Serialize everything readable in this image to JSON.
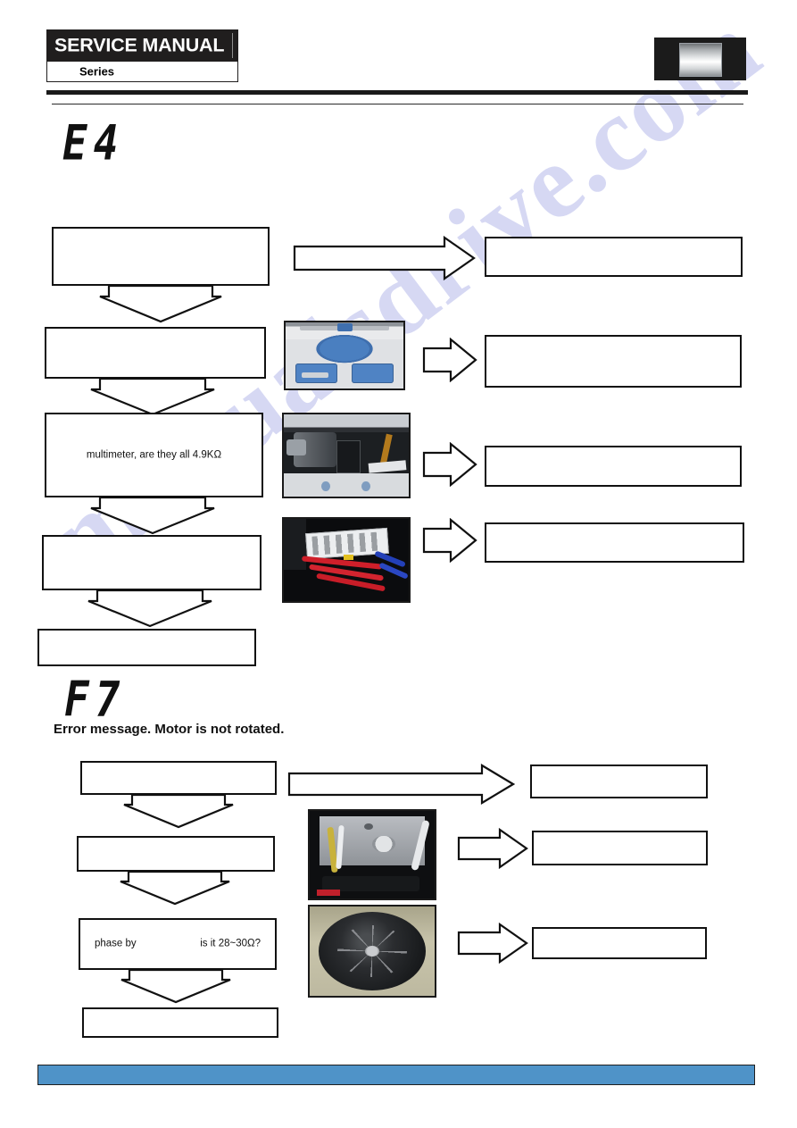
{
  "header": {
    "title": "SERVICE MANUAL",
    "series_label": "Series",
    "logo_name": "brand-logo"
  },
  "sections": [
    {
      "id": "e4",
      "code": "E4",
      "caption": "",
      "flow_boxes": [
        {
          "text": ""
        },
        {
          "text": ""
        },
        {
          "text": "multimeter, are they all 4.9KΩ"
        },
        {
          "text": ""
        },
        {
          "text": ""
        }
      ],
      "result_boxes": [
        {
          "text": ""
        },
        {
          "text": ""
        },
        {
          "text": ""
        },
        {
          "text": ""
        }
      ],
      "photos": [
        {
          "name": "detergent-dispenser-photo"
        },
        {
          "name": "water-inlet-valve-photo"
        },
        {
          "name": "wire-connector-photo"
        }
      ]
    },
    {
      "id": "f7",
      "code": "F7",
      "caption": "Error message. Motor is not rotated.",
      "flow_boxes": [
        {
          "text": ""
        },
        {
          "text": ""
        },
        {
          "text_left": "phase by",
          "text_right": "is it 28~30Ω?"
        },
        {
          "text": ""
        }
      ],
      "result_boxes": [
        {
          "text": ""
        },
        {
          "text": ""
        },
        {
          "text": ""
        }
      ],
      "photos": [
        {
          "name": "motor-harness-photo"
        },
        {
          "name": "motor-rotor-photo"
        }
      ]
    }
  ],
  "watermark": {
    "text": "manualsdrive.com"
  },
  "footer": {
    "bar_text": "",
    "bar_color": "#4f93c8"
  }
}
